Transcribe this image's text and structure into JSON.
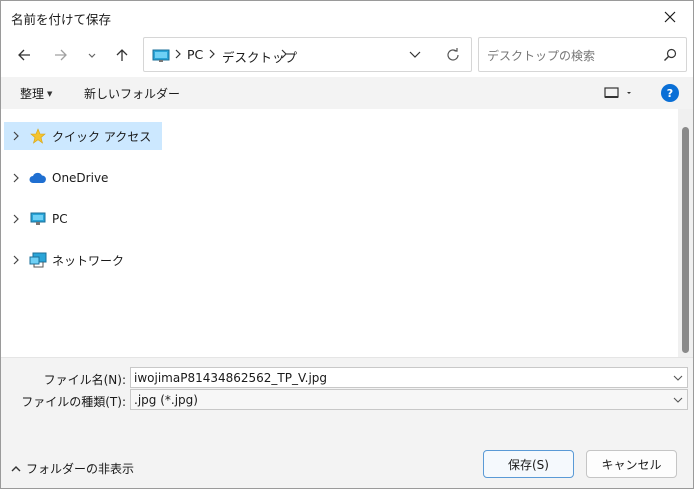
{
  "window": {
    "title": "名前を付けて保存"
  },
  "address": {
    "crumbs": [
      "PC",
      "デスクトップ"
    ]
  },
  "search": {
    "placeholder": "デスクトップの検索"
  },
  "toolbar": {
    "organize": "整理",
    "new_folder": "新しいフォルダー",
    "help": "?"
  },
  "nav": {
    "items": [
      {
        "label": "クイック アクセス",
        "icon": "star-icon"
      },
      {
        "label": "OneDrive",
        "icon": "cloud-icon"
      },
      {
        "label": "PC",
        "icon": "monitor-icon"
      },
      {
        "label": "ネットワーク",
        "icon": "network-icon"
      }
    ]
  },
  "form": {
    "filename_label": "ファイル名(N):",
    "filename_value": "iwojimaP81434862562_TP_V.jpg",
    "filetype_label": "ファイルの種類(T):",
    "filetype_value": ".jpg (*.jpg)"
  },
  "footer": {
    "hide_folders": "フォルダーの非表示",
    "save": "保存(S)",
    "cancel": "キャンセル"
  },
  "colors": {
    "accent": "#0a6fd6",
    "selection": "#cce8ff",
    "star": "#f4c430"
  }
}
